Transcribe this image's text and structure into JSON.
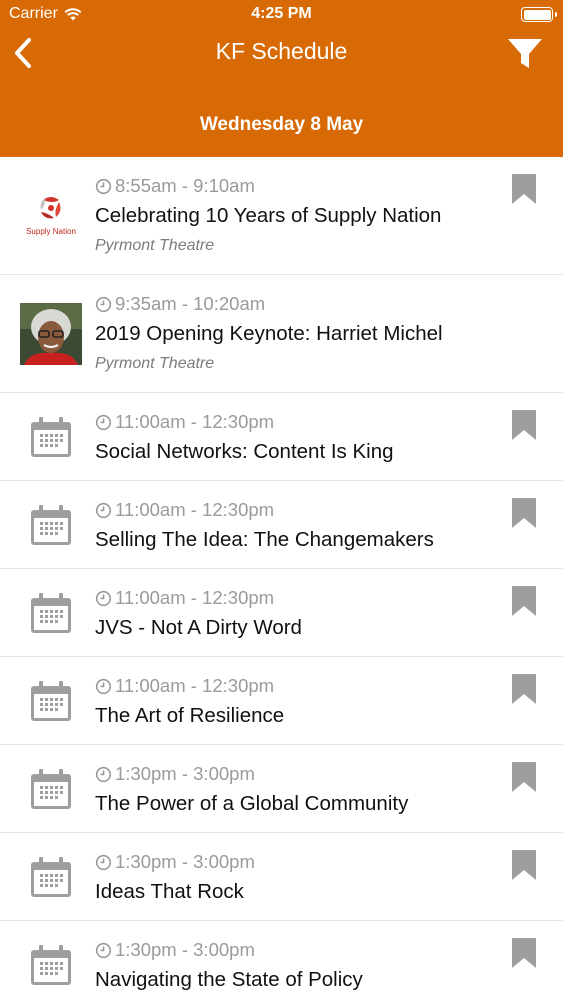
{
  "status_bar": {
    "carrier": "Carrier",
    "time": "4:25 PM"
  },
  "nav": {
    "title": "KF Schedule"
  },
  "day_header": "Wednesday 8 May",
  "colors": {
    "accent": "#d76a04",
    "icon_grey": "#9e9e9e",
    "time_grey": "#9a9a9a"
  },
  "sessions": [
    {
      "time": "8:55am - 9:10am",
      "title": "Celebrating 10 Years of Supply Nation",
      "venue": "Pyrmont Theatre",
      "logo_text": "Supply Nation",
      "thumb": "supply-nation-logo",
      "bookmark": true
    },
    {
      "time": "9:35am - 10:20am",
      "title": "2019 Opening Keynote: Harriet Michel",
      "venue": "Pyrmont Theatre",
      "thumb": "speaker-photo",
      "bookmark": false
    },
    {
      "time": "11:00am - 12:30pm",
      "title": "Social Networks: Content Is King",
      "thumb": "calendar-icon",
      "bookmark": true
    },
    {
      "time": "11:00am - 12:30pm",
      "title": "Selling The Idea: The Changemakers",
      "thumb": "calendar-icon",
      "bookmark": true
    },
    {
      "time": "11:00am - 12:30pm",
      "title": "JVS - Not A Dirty Word",
      "thumb": "calendar-icon",
      "bookmark": true
    },
    {
      "time": "11:00am - 12:30pm",
      "title": "The Art of Resilience",
      "thumb": "calendar-icon",
      "bookmark": true
    },
    {
      "time": "1:30pm - 3:00pm",
      "title": "The Power of a Global Community",
      "thumb": "calendar-icon",
      "bookmark": true
    },
    {
      "time": "1:30pm - 3:00pm",
      "title": "Ideas That Rock",
      "thumb": "calendar-icon",
      "bookmark": true
    },
    {
      "time": "1:30pm - 3:00pm",
      "title": "Navigating the State of Policy",
      "thumb": "calendar-icon",
      "bookmark": true
    }
  ]
}
